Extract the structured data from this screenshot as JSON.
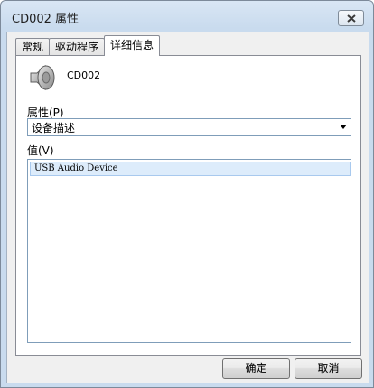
{
  "window": {
    "title": "CD002 属性"
  },
  "tabs": [
    "常规",
    "驱动程序",
    "详细信息"
  ],
  "device": {
    "name": "CD002",
    "icon": "speaker-icon"
  },
  "property": {
    "label": "属性(P)",
    "selected": "设备描述"
  },
  "value_section": {
    "label": "值(V)",
    "items": [
      "USB Audio Device"
    ]
  },
  "buttons": {
    "ok": "确定",
    "cancel": "取消"
  }
}
